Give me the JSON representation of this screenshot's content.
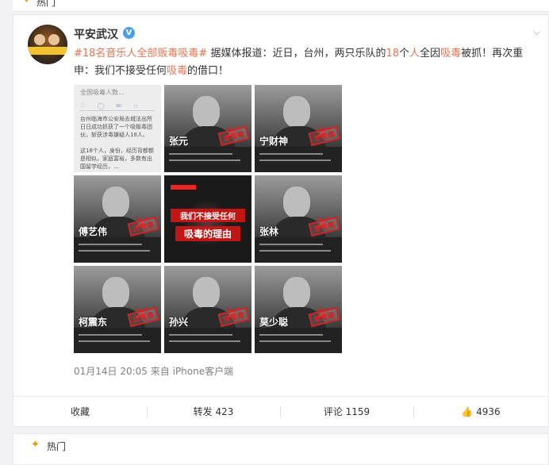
{
  "top_section": {
    "label": "热门"
  },
  "post": {
    "author": "平安武汉",
    "verified_mark": "V",
    "hashtag": "#18名音乐人全部贩毒吸毒#",
    "body_segments": [
      {
        "text": "#18名音乐人全部贩毒吸毒#",
        "highlight": true
      },
      {
        "text": " 据媒体报道：近日，台州，两只乐队的",
        "highlight": false
      },
      {
        "text": "18",
        "highlight": true
      },
      {
        "text": "个",
        "highlight": false
      },
      {
        "text": "人",
        "highlight": true
      },
      {
        "text": "全因",
        "highlight": false
      },
      {
        "text": "吸毒",
        "highlight": true
      },
      {
        "text": "被抓！再次重申：我们不接受任何",
        "highlight": false
      },
      {
        "text": "吸毒",
        "highlight": true
      },
      {
        "text": "的借口！",
        "highlight": false
      }
    ],
    "timestamp": "01月14日 20:05",
    "source_prefix": "来自",
    "source": "iPhone客户端",
    "images": [
      {
        "name": "",
        "stamp": ""
      },
      {
        "name": "张元",
        "stamp": "曾吸毒"
      },
      {
        "name": "宁财神",
        "stamp": "曾吸毒"
      },
      {
        "name": "傅艺伟",
        "stamp": "因吸毒"
      },
      {
        "name": "",
        "stamp": ""
      },
      {
        "name": "张林",
        "stamp": "曾吸毒"
      },
      {
        "name": "柯震东",
        "stamp": "因吸毒"
      },
      {
        "name": "孙兴",
        "stamp": "曾吸毒"
      },
      {
        "name": "莫少聪",
        "stamp": "曾吸毒"
      }
    ],
    "center_image": {
      "line1": "我们不接受任何",
      "line2": "吸毒的理由"
    },
    "doc_image": {
      "title": "全国吸毒人数...",
      "para1": "台州临海市公安局去城法出所日日成功抓获了一个吸贩毒团伙，斩获涉毒嫌疑人18人。",
      "para2": "这18个人，身份，经历背都都是相似，家庭富裕，多数有出国留学经历，..."
    }
  },
  "actions": {
    "favorite": "收藏",
    "repost": "转发 423",
    "comment": "评论 1159",
    "like": "4936"
  },
  "bottom_section": {
    "label": "热门"
  }
}
